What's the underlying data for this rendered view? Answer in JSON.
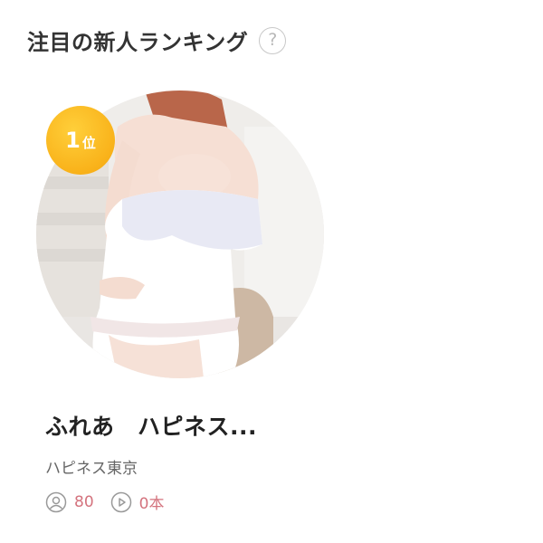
{
  "section": {
    "title": "注目の新人ランキング",
    "help_icon": "question-circle-icon"
  },
  "ranking": [
    {
      "rank_number": "1",
      "rank_suffix": "位",
      "name": "ふれあ　ハピネス...",
      "shop": "ハピネス東京",
      "followers": "80",
      "videos": "0本",
      "follower_icon": "user-circle-icon",
      "video_icon": "play-circle-icon"
    }
  ],
  "colors": {
    "badge": "#f9b21a",
    "stats": "#d4737e",
    "title": "#333333"
  }
}
